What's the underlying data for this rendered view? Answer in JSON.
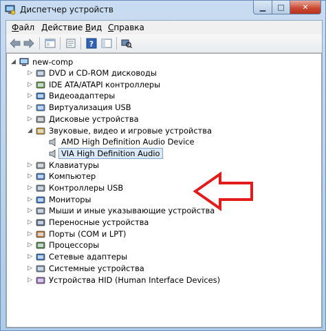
{
  "window": {
    "title": "Диспетчер устройств"
  },
  "menu": [
    "Файл",
    "Действие",
    "Вид",
    "Справка"
  ],
  "menu_underline": [
    "Ф",
    "Д",
    "В",
    "С"
  ],
  "tree": {
    "root": "new-comp",
    "categories": [
      "DVD и CD-ROM дисководы",
      "IDE ATA/ATAPI контроллеры",
      "Видеоадаптеры",
      "Виртуализация USB",
      "Дисковые устройства",
      "Звуковые, видео и игровые устройства",
      "Клавиатуры",
      "Компьютер",
      "Контроллеры USB",
      "Мониторы",
      "Мыши и иные указывающие устройства",
      "Переносные устройства",
      "Порты (COM и LPT)",
      "Процессоры",
      "Сетевые адаптеры",
      "Системные устройства",
      "Устройства HID (Human Interface Devices)"
    ],
    "audio_children": [
      "AMD High Definition Audio Device",
      "VIA High Definition Audio"
    ]
  },
  "annotation_color": "#e41b1b"
}
